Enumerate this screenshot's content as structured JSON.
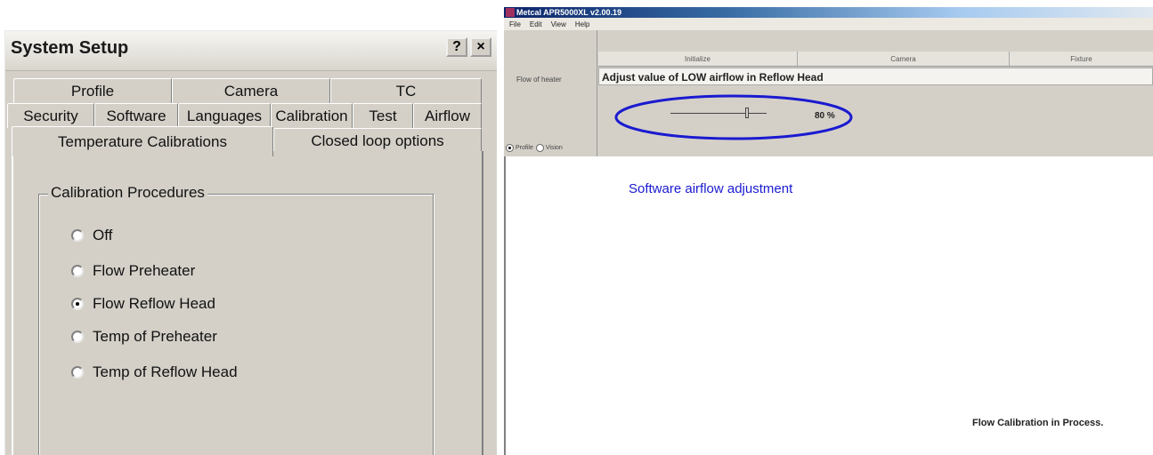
{
  "dialog": {
    "title": "System Setup",
    "help_label": "?",
    "close_label": "×",
    "tabs_row1": [
      "Profile",
      "Camera",
      "TC"
    ],
    "tabs_row2": [
      "Security",
      "Software",
      "Languages",
      "Calibration",
      "Test",
      "Airflow"
    ],
    "tabs_row3": [
      "Temperature Calibrations",
      "Closed loop options"
    ],
    "active_tab": "Temperature Calibrations",
    "group_label": "Calibration Procedures",
    "options": [
      {
        "label": "Off",
        "checked": false
      },
      {
        "label": "Flow Preheater",
        "checked": false
      },
      {
        "label": "Flow Reflow Head",
        "checked": true
      },
      {
        "label": "Temp of Preheater",
        "checked": false
      },
      {
        "label": "Temp of Reflow Head",
        "checked": false
      }
    ]
  },
  "app": {
    "title": "Metcal APR5000XL v2.00.19",
    "menu": [
      "File",
      "Edit",
      "View",
      "Help"
    ],
    "tabs": [
      "Initialize",
      "Camera",
      "Fixture"
    ],
    "flow_label": "Flow of heater",
    "adjust_text": "Adjust value of LOW airflow in Reflow Head",
    "slider_value_pct": 80,
    "slider_readout": "80 %",
    "view_options": [
      {
        "label": "Profile",
        "checked": true
      },
      {
        "label": "Vision",
        "checked": false
      }
    ],
    "status_text": "Flow Calibration in Process."
  },
  "annotation": {
    "text": "Software airflow adjustment",
    "color": "#1a1ad0"
  }
}
